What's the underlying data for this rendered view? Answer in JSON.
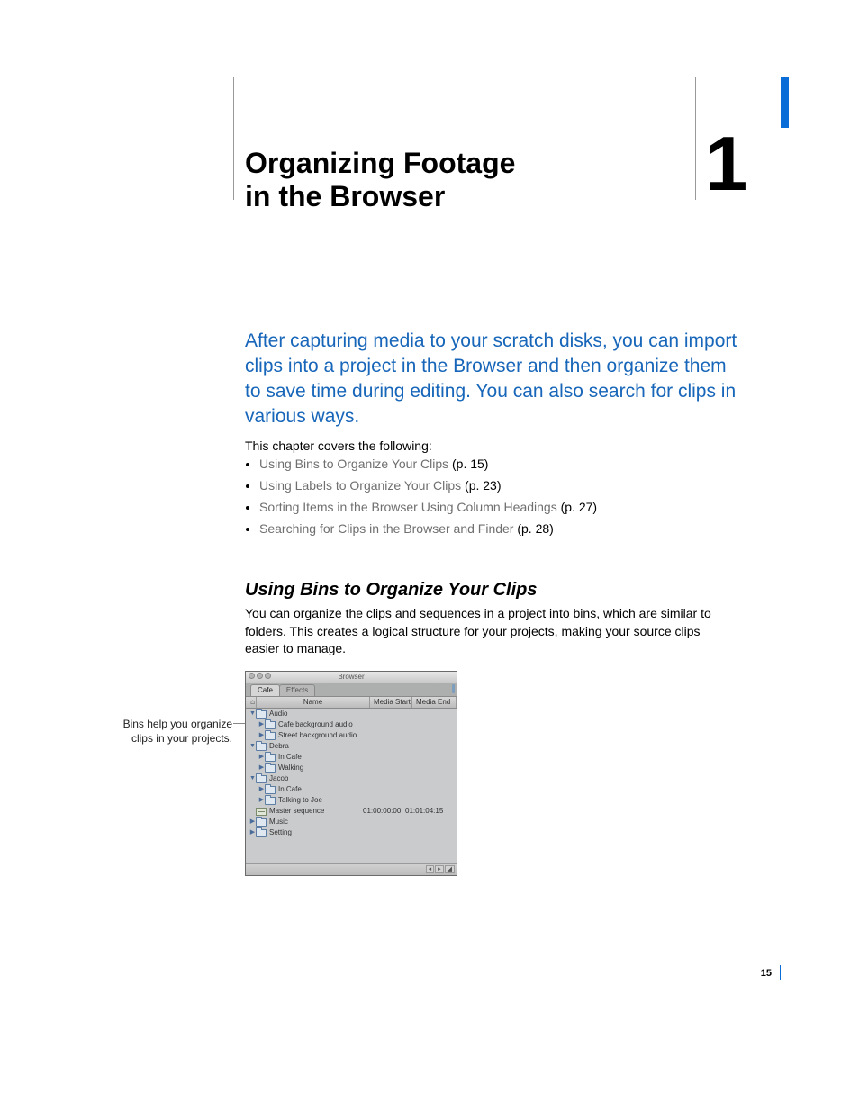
{
  "chapter": {
    "number": "1",
    "title_line1": "Organizing Footage",
    "title_line2": "in the Browser"
  },
  "lead": "After capturing media to your scratch disks, you can import clips into a project in the Browser and then organize them to save time during editing. You can also search for clips in various ways.",
  "covers_label": "This chapter covers the following:",
  "toc": [
    {
      "text": "Using Bins to Organize Your Clips",
      "page": "(p. 15)"
    },
    {
      "text": "Using Labels to Organize Your Clips",
      "page": "(p. 23)"
    },
    {
      "text": "Sorting Items in the Browser Using Column Headings",
      "page": "(p. 27)"
    },
    {
      "text": "Searching for Clips in the Browser and Finder",
      "page": "(p. 28)"
    }
  ],
  "section": {
    "heading": "Using Bins to Organize Your Clips",
    "body": "You can organize the clips and sequences in a project into bins, which are similar to folders. This creates a logical structure for your projects, making your source clips easier to manage."
  },
  "callout": "Bins help you organize clips in your projects.",
  "browser": {
    "window_title": "Browser",
    "tabs": [
      "Cafe",
      "Effects"
    ],
    "columns": {
      "name": "Name",
      "media_start": "Media Start",
      "media_end": "Media End"
    },
    "rows": [
      {
        "type": "bin",
        "level": 0,
        "disclosure": "open",
        "name": "Audio"
      },
      {
        "type": "bin",
        "level": 1,
        "disclosure": "closed",
        "name": "Cafe background audio"
      },
      {
        "type": "bin",
        "level": 1,
        "disclosure": "closed",
        "name": "Street background audio"
      },
      {
        "type": "bin",
        "level": 0,
        "disclosure": "open",
        "name": "Debra"
      },
      {
        "type": "bin",
        "level": 1,
        "disclosure": "closed",
        "name": "In Cafe"
      },
      {
        "type": "bin",
        "level": 1,
        "disclosure": "closed",
        "name": "Walking"
      },
      {
        "type": "bin",
        "level": 0,
        "disclosure": "open",
        "name": "Jacob"
      },
      {
        "type": "bin",
        "level": 1,
        "disclosure": "closed",
        "name": "In Cafe"
      },
      {
        "type": "bin",
        "level": 1,
        "disclosure": "closed",
        "name": "Talking to Joe"
      },
      {
        "type": "seq",
        "level": 0,
        "disclosure": "",
        "name": "Master sequence",
        "media_start": "01:00:00:00",
        "media_end": "01:01:04:15"
      },
      {
        "type": "bin",
        "level": 0,
        "disclosure": "closed",
        "name": "Music"
      },
      {
        "type": "bin",
        "level": 0,
        "disclosure": "closed",
        "name": "Setting"
      }
    ]
  },
  "page_number": "15"
}
